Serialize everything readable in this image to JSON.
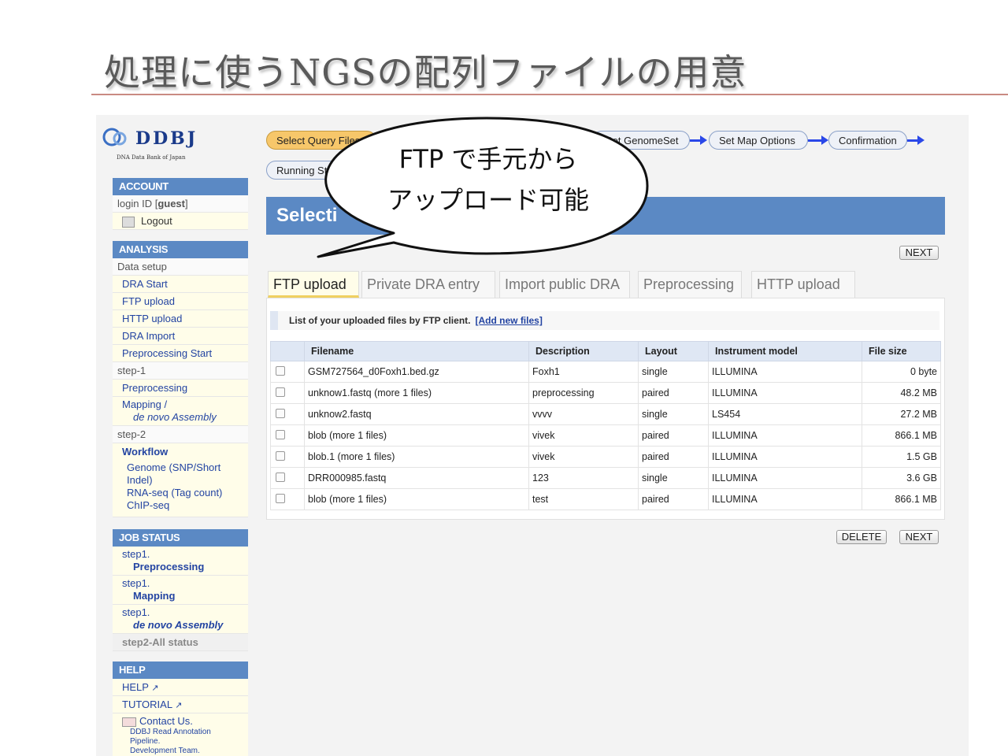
{
  "slide_title": "処理に使うNGSの配列ファイルの用意",
  "callout": {
    "line1": "FTP で手元から",
    "line2": "アップロード可能"
  },
  "logo": {
    "name": "DDBJ",
    "subtitle": "DNA Data Bank of Japan"
  },
  "sidebar": {
    "account": {
      "header": "ACCOUNT",
      "login_label": "login ID [",
      "login_user": "guest",
      "login_close": "]",
      "logout": "Logout"
    },
    "analysis": {
      "header": "ANALYSIS",
      "data_setup": "Data setup",
      "items": [
        "DRA Start",
        "FTP upload",
        "HTTP upload",
        "DRA Import",
        "Preprocessing Start"
      ],
      "step1": "step-1",
      "preprocessing": "Preprocessing",
      "mapping": "Mapping /",
      "de_novo": "de novo Assembly",
      "step2": "step-2",
      "workflow": "Workflow",
      "genome": "Genome (SNP/Short",
      "indel": "Indel)",
      "rnaseq": "RNA-seq (Tag count)",
      "chipseq": "ChIP-seq"
    },
    "job_status": {
      "header": "JOB STATUS",
      "s1": "step1.",
      "preprocessing": "Preprocessing",
      "s2": "step1.",
      "mapping": "Mapping",
      "s3": "step1.",
      "denovo": "de novo Assembly",
      "all": "step2-All status"
    },
    "help": {
      "header": "HELP",
      "help": "HELP",
      "tutorial": "TUTORIAL",
      "contact": "Contact Us.",
      "team1": "DDBJ Read Annotation",
      "team2": "Pipeline.",
      "team3": "Development Team."
    }
  },
  "steps": {
    "select_query": "Select Query Files",
    "running": "Running Sta",
    "set_genome": "Set GenomeSet",
    "set_map": "Set Map Options",
    "confirmation": "Confirmation"
  },
  "banner_title": "Selecti",
  "buttons": {
    "next": "NEXT",
    "delete": "DELETE"
  },
  "tabs": [
    "FTP upload",
    "Private DRA entry",
    "Import public DRA",
    "Preprocessing",
    "HTTP upload"
  ],
  "info": {
    "text": "List of your uploaded files by FTP client.",
    "link": "[Add new files]"
  },
  "table": {
    "headers": [
      "",
      "Filename",
      "Description",
      "Layout",
      "Instrument model",
      "File size"
    ],
    "rows": [
      [
        "",
        "GSM727564_d0Foxh1.bed.gz",
        "Foxh1",
        "single",
        "ILLUMINA",
        "0 byte"
      ],
      [
        "",
        "unknow1.fastq  (more 1 files)",
        "preprocessing",
        "paired",
        "ILLUMINA",
        "48.2 MB"
      ],
      [
        "",
        "unknow2.fastq",
        "vvvv",
        "single",
        "LS454",
        "27.2 MB"
      ],
      [
        "",
        "blob  (more 1 files)",
        "vivek",
        "paired",
        "ILLUMINA",
        "866.1 MB"
      ],
      [
        "",
        "blob.1  (more 1 files)",
        "vivek",
        "paired",
        "ILLUMINA",
        "1.5 GB"
      ],
      [
        "",
        "DRR000985.fastq",
        "123",
        "single",
        "ILLUMINA",
        "3.6 GB"
      ],
      [
        "",
        "blob  (more 1 files)",
        "test",
        "paired",
        "ILLUMINA",
        "866.1 MB"
      ]
    ]
  }
}
